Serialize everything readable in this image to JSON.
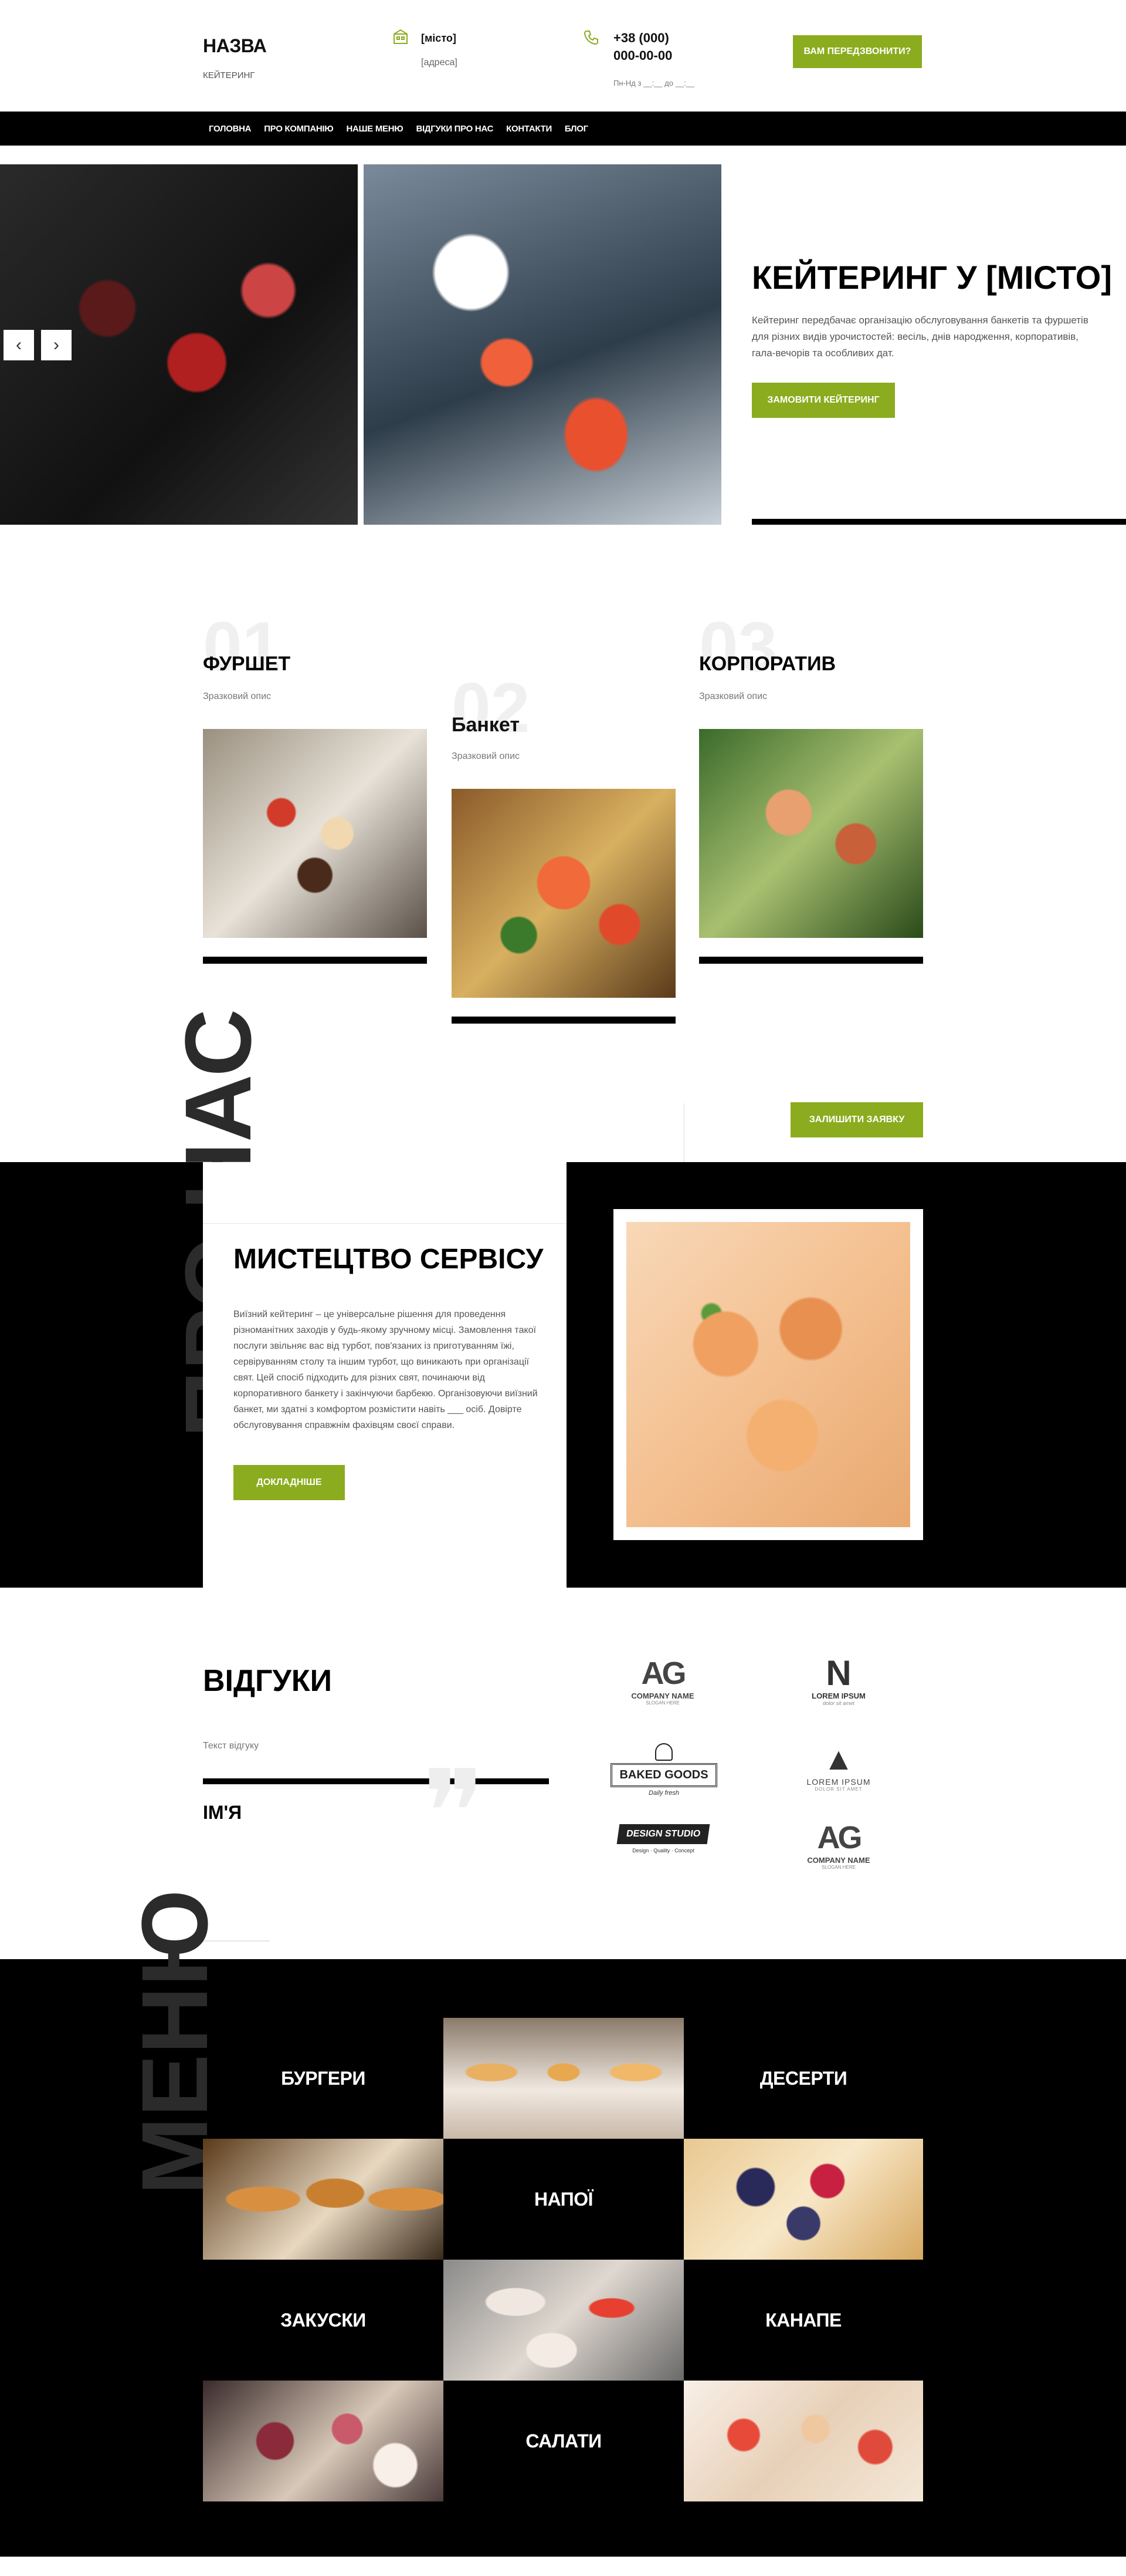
{
  "header": {
    "brand_name": "НАЗВА",
    "brand_tagline": "КЕЙТЕРИНГ",
    "city": "[місто]",
    "address": "[адреса]",
    "phone_line1": "+38 (000)",
    "phone_line2": "000-00-00",
    "hours": "Пн-Нд з __:__ до __:__",
    "callback_button": "ВАМ ПЕРЕДЗВОНИТИ?"
  },
  "nav": {
    "items": [
      "ГОЛОВНА",
      "ПРО КОМПАНІЮ",
      "НАШЕ МЕНЮ",
      "ВІДГУКИ ПРО НАС",
      "КОНТАКТИ",
      "БЛОГ"
    ]
  },
  "hero": {
    "title": "КЕЙТЕРИНГ У [МІСТО]",
    "description": "Кейтеринг передбачає організацію обслуговування банкетів та фуршетів для різних видів урочистостей: весіль, днів народження, корпоративів, гала-вечорів та особливих дат.",
    "order_button": "ЗАМОВИТИ КЕЙТЕРИНГ",
    "prev_arrow": "‹",
    "next_arrow": "›"
  },
  "services": {
    "items": [
      {
        "number": "01",
        "title": "ФУРШЕТ",
        "desc": "Зразковий опис"
      },
      {
        "number": "02",
        "title": "Банкет",
        "desc": "Зразковий опис"
      },
      {
        "number": "03",
        "title": "КОРПОРАТИВ",
        "desc": "Зразковий опис"
      }
    ],
    "request_button": "ЗАЛИШИТИ ЗАЯВКУ"
  },
  "about": {
    "ghost_word": "ПРО НАС",
    "title": "МИСТЕЦТВО СЕРВІСУ",
    "text": "Виїзний кейтеринг – це універсальне рішення для проведення різноманітних заходів у будь-якому зручному місці. Замовлення такої послуги звільняє вас від турбот, пов'язаних із приготуванням їжі, сервіруванням столу та іншим турбот, що виникають при організації свят. Цей спосіб підходить для різних свят, починаючи від корпоративного банкету і закінчуючи барбекю. Організовуючи виїзний банкет, ми здатні з комфортом розмістити навіть ___ осіб. Довірте обслуговування справжнім фахівцям своєї справи.",
    "more_button": "ДОКЛАДНІШЕ"
  },
  "reviews": {
    "title": "ВІДГУКИ",
    "review_text": "Текст відгуку",
    "author": "ІМ'Я",
    "quote_glyph": "❞"
  },
  "logos": {
    "items": [
      {
        "mark": "AG",
        "caption": "COMPANY NAME",
        "sub": "SLOGAN HERE"
      },
      {
        "mark": "N",
        "caption": "LOREM IPSUM",
        "sub": "dolor sit amet"
      },
      {
        "mark": "BAKED GOODS",
        "caption": "Daily fresh",
        "sub": ""
      },
      {
        "mark": "▲",
        "caption": "LOREM IPSUM",
        "sub": "DOLOR SIT AMET"
      },
      {
        "mark": "DESIGN STUDIO",
        "caption": "Design · Quality · Concept",
        "sub": ""
      },
      {
        "mark": "AG",
        "caption": "COMPANY NAME",
        "sub": "SLOGAN HERE"
      }
    ]
  },
  "menu": {
    "ghost_word": "МЕНЮ",
    "categories": {
      "burgers": "БУРГЕРИ",
      "desserts": "ДЕСЕРТИ",
      "drinks": "НАПОЇ",
      "snacks": "ЗАКУСКИ",
      "canapes": "КАНАПЕ",
      "salads": "САЛАТИ"
    }
  },
  "colors": {
    "accent": "#8bac1e",
    "dark": "#000000"
  }
}
